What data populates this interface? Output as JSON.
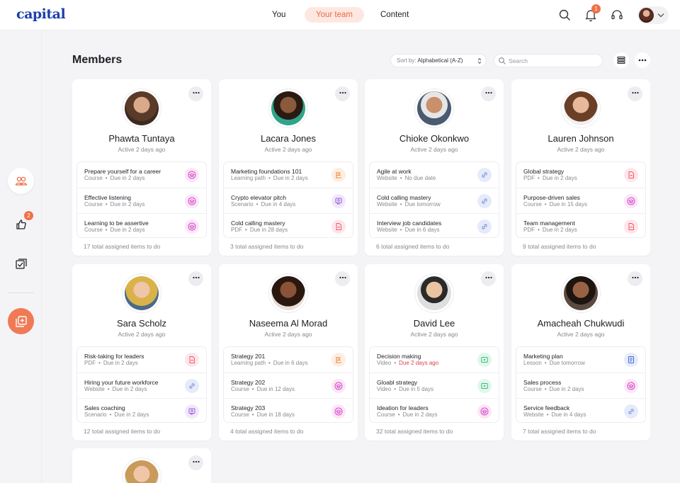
{
  "app": {
    "logo": "capital"
  },
  "nav": {
    "tabs": [
      "You",
      "Your team",
      "Content"
    ],
    "active": "Your team"
  },
  "topbar": {
    "notification_count": "1"
  },
  "sidebar": {
    "likes_badge": "2"
  },
  "page": {
    "title": "Members",
    "sort_label": "Sort by:",
    "sort_value": "Alphabetical (A-Z)",
    "search_placeholder": "Search"
  },
  "colors": {
    "accent": "#f07a55",
    "link_icon": "#6b82d8",
    "course_icon": "#d645c8",
    "pdf_icon": "#ef5a6a",
    "video_icon": "#2fbf7a",
    "late_text": "#e0404a"
  },
  "members": [
    {
      "name": "Phawta Tuntaya",
      "active": "Active 2 days ago",
      "total": "17 total assigned items to do",
      "items": [
        {
          "title": "Prepare yourself for a career",
          "type": "Course",
          "due": "Due in 2 days",
          "icon": "course-icon"
        },
        {
          "title": "Effective listening",
          "type": "Course",
          "due": "Due in 2 days",
          "icon": "course-icon"
        },
        {
          "title": "Learning to be assertive",
          "type": "Course",
          "due": "Due in 2 days",
          "icon": "course-icon"
        }
      ]
    },
    {
      "name": "Lacara Jones",
      "active": "Active 2 days ago",
      "total": "3 total assigned items to do",
      "items": [
        {
          "title": "Marketing foundations 101",
          "type": "Learning path",
          "due": "Due in 2 days",
          "icon": "learning-path-icon"
        },
        {
          "title": "Crypto elevator pitch",
          "type": "Scenario",
          "due": "Due in 4 days",
          "icon": "scenario-icon"
        },
        {
          "title": "Cold calling mastery",
          "type": "PDF",
          "due": "Due in 28 days",
          "icon": "pdf-icon"
        }
      ]
    },
    {
      "name": "Chioke Okonkwo",
      "active": "Active 2 days ago",
      "total": "6 total assigned items to do",
      "items": [
        {
          "title": "Agile at work",
          "type": "Website",
          "due": "No due date",
          "icon": "link-icon"
        },
        {
          "title": "Cold calling mastery",
          "type": "Website",
          "due": "Due tomorrow",
          "icon": "link-icon"
        },
        {
          "title": "Interview job candidates",
          "type": "Website",
          "due": "Due in 6 days",
          "icon": "link-icon"
        }
      ]
    },
    {
      "name": "Lauren Johnson",
      "active": "Active 2 days ago",
      "total": "9 total assigned items to do",
      "items": [
        {
          "title": "Global strategy",
          "type": "PDF",
          "due": "Due in 2 days",
          "icon": "pdf-icon"
        },
        {
          "title": "Purpose-driven sales",
          "type": "Course",
          "due": "Due in 15 days",
          "icon": "course-icon"
        },
        {
          "title": "Team management",
          "type": "PDF",
          "due": "Due in 2 days",
          "icon": "pdf-icon"
        }
      ]
    },
    {
      "name": "Sara Scholz",
      "active": "Active 2 days ago",
      "total": "12 total assigned items to do",
      "items": [
        {
          "title": "Risk-taking for leaders",
          "type": "PDF",
          "due": "Due in 2 days",
          "icon": "pdf-icon"
        },
        {
          "title": "Hiring your future workforce",
          "type": "Website",
          "due": "Due in 2 days",
          "icon": "link-icon"
        },
        {
          "title": "Sales coaching",
          "type": "Scenario",
          "due": "Due in 2 days",
          "icon": "scenario-icon"
        }
      ]
    },
    {
      "name": "Naseema Al Morad",
      "active": "Active 2 days ago",
      "total": "4 total assigned items to do",
      "items": [
        {
          "title": "Strategy 201",
          "type": "Learning path",
          "due": "Due in 6 days",
          "icon": "learning-path-icon"
        },
        {
          "title": "Strategy 202",
          "type": "Course",
          "due": "Due in 12 days",
          "icon": "course-icon"
        },
        {
          "title": "Strategy 203",
          "type": "Course",
          "due": "Due in 18 days",
          "icon": "course-icon"
        }
      ]
    },
    {
      "name": "David Lee",
      "active": "Active 2 days ago",
      "total": "32 total assigned items to do",
      "items": [
        {
          "title": "Decision making",
          "type": "Video",
          "due": "Due 2 days ago",
          "icon": "video-icon",
          "late": true
        },
        {
          "title": "Gloabl strategy",
          "type": "Video",
          "due": "Due in 5 days",
          "icon": "video-icon"
        },
        {
          "title": "Ideation for leaders",
          "type": "Course",
          "due": "Due in 2 days",
          "icon": "course-icon"
        }
      ]
    },
    {
      "name": "Amacheah Chukwudi",
      "active": "Active 2 days ago",
      "total": "7 total assigned items to do",
      "items": [
        {
          "title": "Marketing plan",
          "type": "Lesson",
          "due": "Due tomorrow",
          "icon": "lesson-icon"
        },
        {
          "title": "Sales process",
          "type": "Course",
          "due": "Due in 2 days",
          "icon": "course-icon"
        },
        {
          "title": "Service feedback",
          "type": "Website",
          "due": "Due in 4 days",
          "icon": "link-icon"
        }
      ]
    }
  ]
}
